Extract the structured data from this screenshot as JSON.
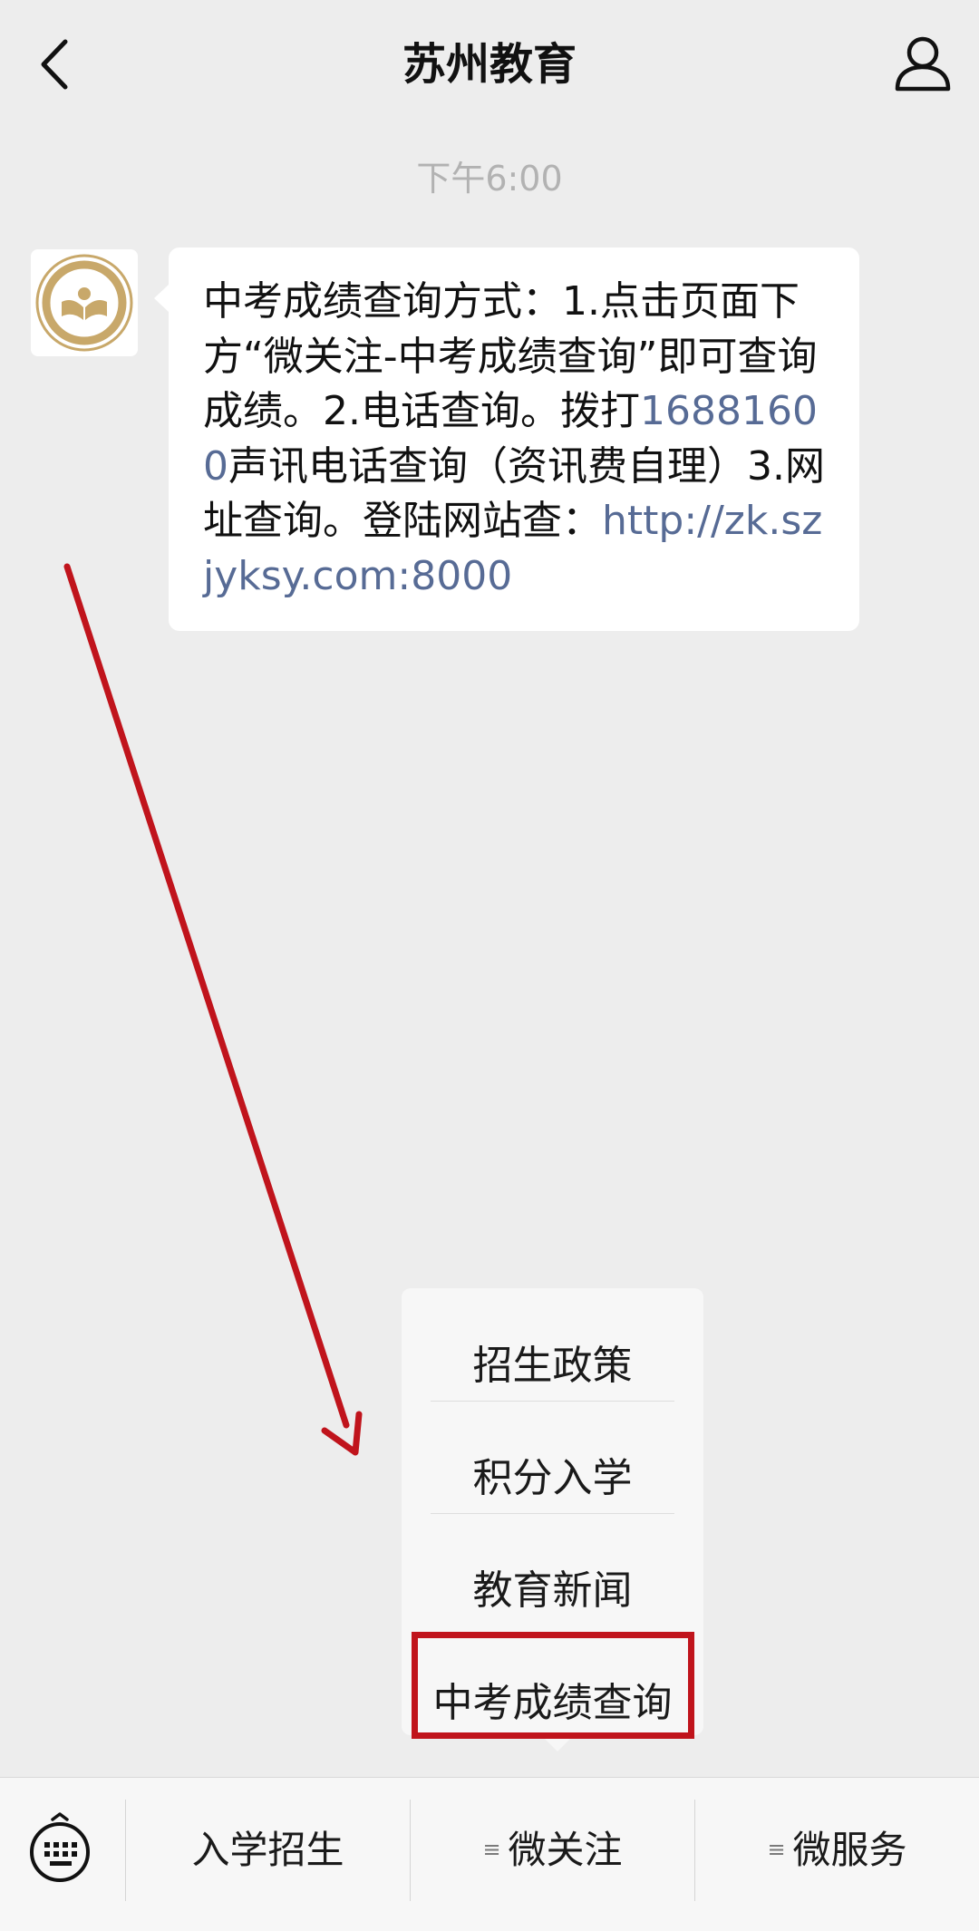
{
  "header": {
    "title": "苏州教育",
    "back_icon": "chevron-left-icon",
    "profile_icon": "user-icon"
  },
  "chat": {
    "timestamp": "下午6:00",
    "avatar_icon": "suzhou-education-logo",
    "message": {
      "text_1": "中考成绩查询方式：1.点击页面下方“微关注-中考成绩查询”即可查询成绩。2.电话查询。拨打",
      "phone_link": "16881600",
      "text_2": "声讯电话查询（资讯费自理）3.网址查询。登陆网站查：",
      "url_link": "http://zk.szjyksy.com:8000"
    }
  },
  "popup_menu": {
    "items": [
      {
        "label": "招生政策"
      },
      {
        "label": "积分入学"
      },
      {
        "label": "教育新闻"
      },
      {
        "label": "中考成绩查询"
      }
    ]
  },
  "bottom_bar": {
    "keyboard_icon": "keyboard-icon",
    "items": [
      {
        "label": "入学招生"
      },
      {
        "label": "微关注"
      },
      {
        "label": "微服务"
      }
    ]
  },
  "colors": {
    "background": "#ededed",
    "bubble": "#ffffff",
    "link": "#576b95",
    "annotation_red": "#c0141c"
  }
}
